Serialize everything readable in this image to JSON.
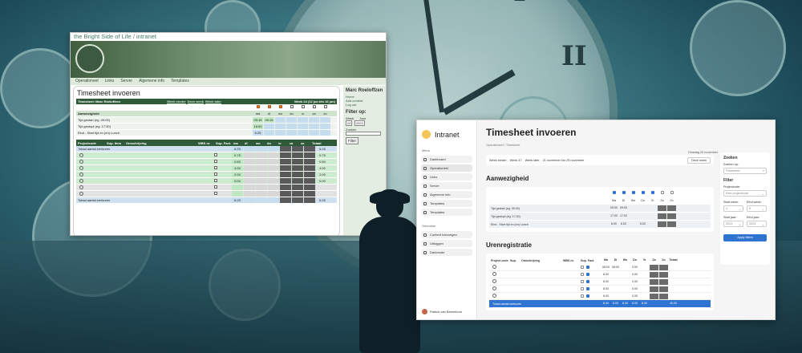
{
  "old_app": {
    "site_title": "the Bright Side of Life",
    "site_section": "intranet",
    "nav": [
      "Operationeel",
      "Links",
      "Server",
      "Algemene info",
      "Templates"
    ],
    "page_title": "Timesheet invoeren",
    "user_header": "Timesheet: Marc Roeloffzen",
    "week_links": [
      "Week eerder",
      "Deze week",
      "Week later"
    ],
    "week_label": "Week 24 (12 jun t/m 16 jun)",
    "days": [
      "ma",
      "di",
      "wo",
      "do",
      "vr",
      "za",
      "zo"
    ],
    "presence_title": "Aanwezigheid",
    "presence_rows": [
      {
        "label": "Tijd gestart (eg. 09:00)",
        "values": [
          "09:15",
          "09:15",
          "",
          "",
          "",
          "",
          ""
        ]
      },
      {
        "label": "Tijd gestopt (eg. 17:30)",
        "values": [
          "16:00",
          "",
          "",
          "",
          "",
          "",
          ""
        ]
      },
      {
        "label": "Eind - Start tijd en (en) Lunch",
        "values": [
          "6.25",
          "",
          "",
          "",
          "",
          "",
          ""
        ]
      }
    ],
    "hours_headers": [
      "Projectcode",
      "Sup. Item",
      "Omschrijving",
      "WBS nr.",
      "Sup. Fact.",
      "ma",
      "di",
      "wo",
      "do",
      "vr",
      "za",
      "zo",
      "Totaal"
    ],
    "hours_rows": [
      {
        "label": "Totaal aantal werkuren",
        "mon": "6.25",
        "total": "6.25"
      },
      {
        "label": "",
        "mon": "0.75",
        "total": "0.75"
      },
      {
        "label": "",
        "mon": "0.50",
        "total": "0.50"
      },
      {
        "label": "",
        "mon": "4.00",
        "total": "4.00"
      },
      {
        "label": "",
        "mon": "2.00",
        "total": "2.00"
      },
      {
        "label": "",
        "mon": "0.00",
        "total": "0.00"
      },
      {
        "label": "",
        "mon": "",
        "total": ""
      },
      {
        "label": "",
        "mon": "",
        "total": ""
      },
      {
        "label": "Totaal aantal werkuren",
        "mon": "6.25",
        "total": "6.25"
      }
    ],
    "sidebar": {
      "name": "Marc Roeloffzen",
      "links": [
        "Home",
        "Add content",
        "Log out"
      ],
      "filter_title": "Filter op:",
      "week_label": "Week",
      "week_value": "24",
      "year_label": "Jaar",
      "year_value": "2023",
      "search_label": "Zoeken",
      "filter_button": "Filter"
    }
  },
  "new_app": {
    "brand": "Intranet",
    "menu_label": "Menu",
    "menu": [
      "Dashboard",
      "Operationeel",
      "Links",
      "Server",
      "Algemene info",
      "Templates",
      "Templates"
    ],
    "user_label": "Gebruiker",
    "user_menu": [
      "Content toevoegen",
      "Uitloggen",
      "Darkmode"
    ],
    "user_name": "Patrick van Bennekom",
    "page_title": "Timesheet invoeren",
    "breadcrumb": "Operationeel / Timesheet",
    "date": "Dinsdag 20 november",
    "week_nav": [
      "Week eerder",
      "Week 47",
      "Week later"
    ],
    "week_range": "21 november t/m 25 november",
    "this_week": "Deze week",
    "presence_title": "Aanwezigheid",
    "days": [
      "Ma",
      "Di",
      "Wo",
      "Do",
      "Vr",
      "Za",
      "Zo"
    ],
    "presence_rows": [
      {
        "label": "Tijd gestart (eg. 09:00)",
        "values": [
          "09:00",
          "09:00",
          "",
          "",
          "",
          "",
          ""
        ]
      },
      {
        "label": "Tijd gestopt (eg. 17:30)",
        "values": [
          "17:00",
          "17:00",
          "",
          "",
          "",
          "",
          ""
        ]
      },
      {
        "label": "Eind - Start tijd en (en) Lunch",
        "values": [
          "8.00",
          "8.00",
          "",
          "8.00",
          "",
          "",
          ""
        ]
      }
    ],
    "hours_title": "Urenregistratie",
    "hours_headers": [
      "Project code",
      "Sup.",
      "Omschrijving",
      "WBS nr.",
      "Sup. Fact.",
      "Ma",
      "Di",
      "Wo",
      "Do",
      "Vr",
      "Za",
      "Zo",
      "Totaal"
    ],
    "hours_rows": [
      {
        "values": [
          "08:00",
          "08:00",
          "",
          "0.00"
        ]
      },
      {
        "values": [
          "8.00",
          "",
          "",
          "0.00"
        ]
      },
      {
        "values": [
          "8.00",
          "",
          "",
          "0.00"
        ]
      },
      {
        "values": [
          "8.00",
          "",
          "",
          "0.00"
        ]
      },
      {
        "values": [
          "8.00",
          "",
          "",
          "0.00"
        ]
      }
    ],
    "hours_total_label": "Totaal aantal werkuren",
    "hours_total_values": [
      "8.00",
      "8.00",
      "8.00",
      "8.00",
      "8.00",
      "",
      "",
      "40.00"
    ],
    "filters": {
      "title": "Zoeken",
      "search_label": "Zoeken op:",
      "search_placeholder": "Parameter",
      "filter_title": "Filter",
      "project_label": "Projectcode:",
      "project_placeholder": "Kies projectcode",
      "start_week_label": "Start week:",
      "end_week_label": "Eind week:",
      "start_week_value": "4",
      "end_week_value": "5",
      "start_year_label": "Start jaar:",
      "end_year_label": "Eind jaar:",
      "start_year_value": "2024",
      "end_year_value": "2024",
      "apply": "Apply filters"
    }
  }
}
